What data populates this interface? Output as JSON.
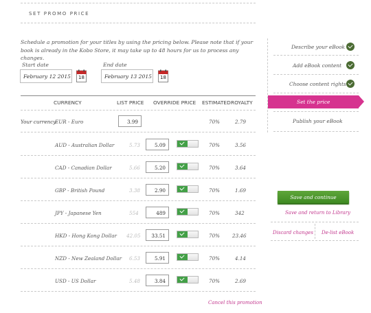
{
  "page": {
    "title": "SET PROMO PRICE"
  },
  "intro": "Schedule a promotion for your titles by using the pricing below. Please note that if your book is already in the Kobo Store, it may take up to 48 hours for us to process any changes.",
  "dates": {
    "start_label": "Start date",
    "start_value": "February 12 2015",
    "end_label": "End date",
    "end_value": "February 13 2015",
    "calendar_day": "18"
  },
  "table": {
    "headers": {
      "currency": "CURRENCY",
      "list_price": "LIST PRICE",
      "override_price": "OVERRIDE PRICE",
      "estimated": "ESTIMATED",
      "royalty": "ROYALTY"
    },
    "your_currency_label": "Your currency",
    "your_row": {
      "currency": "EUR - Euro",
      "price": "3.99",
      "percent": "70%",
      "royalty": "2.79"
    },
    "rows": [
      {
        "currency": "AUD - Australian Dollar",
        "list": "5.73",
        "override": "5.09",
        "percent": "70%",
        "royalty": "3.56"
      },
      {
        "currency": "CAD - Canadian Dollar",
        "list": "5.66",
        "override": "5.20",
        "percent": "70%",
        "royalty": "3.64"
      },
      {
        "currency": "GBP - British Pound",
        "list": "3.38",
        "override": "2.90",
        "percent": "70%",
        "royalty": "1.69"
      },
      {
        "currency": "JPY - Japanese Yen",
        "list": "554",
        "override": "489",
        "percent": "70%",
        "royalty": "342"
      },
      {
        "currency": "HKD - Hong Kong Dollar",
        "list": "42.05",
        "override": "33.51",
        "percent": "70%",
        "royalty": "23.46"
      },
      {
        "currency": "NZD - New Zealand Dollar",
        "list": "6.53",
        "override": "5.91",
        "percent": "70%",
        "royalty": "4.14"
      },
      {
        "currency": "USD - US Dollar",
        "list": "5.48",
        "override": "3.84",
        "percent": "70%",
        "royalty": "2.69"
      }
    ],
    "cancel_link": "Cancel this promotion"
  },
  "steps": [
    {
      "label": "Describe your eBook",
      "done": true
    },
    {
      "label": "Add eBook content",
      "done": true
    },
    {
      "label": "Choose content rights",
      "done": true
    },
    {
      "label": "Set the price",
      "active": true
    },
    {
      "label": "Publish your eBook",
      "done": false
    }
  ],
  "actions": {
    "save_continue": "Save and continue",
    "save_return": "Save and return to Library",
    "discard": "Discard changes",
    "delist": "De-list eBook"
  },
  "colors": {
    "accent": "#d6338f",
    "success": "#43a047",
    "save_button": "#4e9a2e",
    "check_badge": "#4b6b33"
  },
  "icons": {
    "calendar": "calendar-icon",
    "check": "check-icon",
    "toggle": "toggle-switch"
  }
}
